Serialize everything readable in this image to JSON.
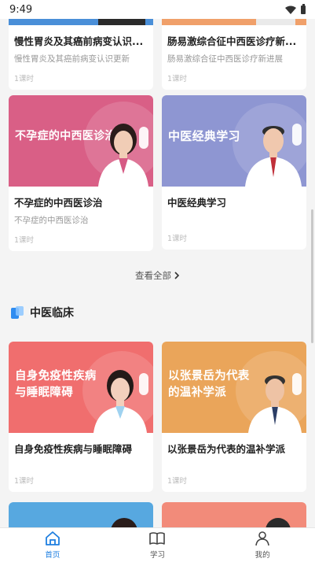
{
  "status": {
    "time": "9:49"
  },
  "top_row": [
    {
      "title": "慢性胃炎及其癌前病变认识...",
      "subtitle": "慢性胃炎及其癌前病变认识更新",
      "meta": "1课时"
    },
    {
      "title": "肠易激综合征中西医诊疗新...",
      "subtitle": "肠易激综合征中西医诊疗新进展",
      "meta": "1课时"
    }
  ],
  "row2": [
    {
      "banner": "不孕症的中西医诊治",
      "title": "不孕症的中西医诊治",
      "subtitle": "不孕症的中西医诊治",
      "meta": "1课时",
      "color": "#d95f86"
    },
    {
      "banner": "中医经典学习",
      "title": "中医经典学习",
      "subtitle": "",
      "meta": "1课时",
      "color": "#8e96d2"
    }
  ],
  "view_all": "查看全部",
  "section": {
    "title": "中医临床",
    "accent": "#2f8cf0"
  },
  "row3": [
    {
      "banner_line1": "自身免疫性疾病",
      "banner_line2": "与睡眠障碍",
      "title": "自身免疫性疾病与睡眠障碍",
      "meta": "1课时",
      "color": "#f06e6e"
    },
    {
      "banner_line1": "以张景岳为代表",
      "banner_line2": "的温补学派",
      "title": "以张景岳为代表的温补学派",
      "meta": "1课时",
      "color": "#eaa55a"
    }
  ],
  "row4_colors": [
    "#57a8e0",
    "#f28b7a"
  ],
  "tabs": [
    {
      "label": "首页",
      "icon": "home-icon",
      "active": true
    },
    {
      "label": "学习",
      "icon": "book-icon",
      "active": false
    },
    {
      "label": "我的",
      "icon": "profile-icon",
      "active": false
    }
  ],
  "colors": {
    "primary": "#1f7fe0"
  }
}
